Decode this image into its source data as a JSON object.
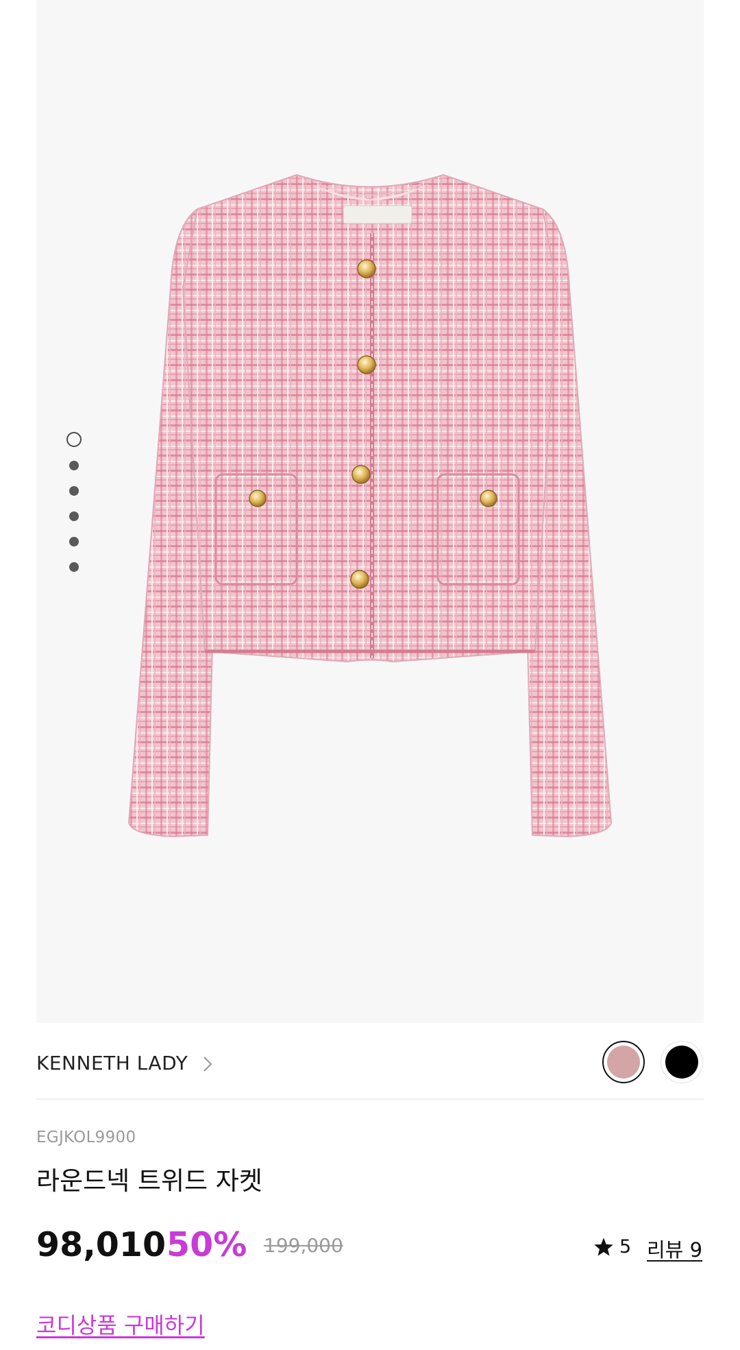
{
  "gallery": {
    "image_label": "라운드넥 트위드 자켓",
    "collar_label_text": "Kenneth lady",
    "slides_total": 6,
    "active_slide": 1
  },
  "brand": {
    "name": "KENNETH LADY"
  },
  "colors": {
    "swatches": [
      {
        "name": "pink",
        "hex": "#d3a5a5",
        "selected": true
      },
      {
        "name": "black",
        "hex": "#000000",
        "selected": false
      }
    ],
    "accent": "#c83bd6"
  },
  "product": {
    "code": "EGJKOL9900",
    "title": "라운드넥 트위드 자켓",
    "price": "98,010",
    "discount": "50%",
    "original_price": "199,000",
    "rating": "5",
    "review_label": "리뷰 9"
  },
  "links": {
    "coordi": "코디상품 구매하기"
  },
  "icons": {
    "rating": "star-icon",
    "brand_link": "chevron-right-icon"
  }
}
